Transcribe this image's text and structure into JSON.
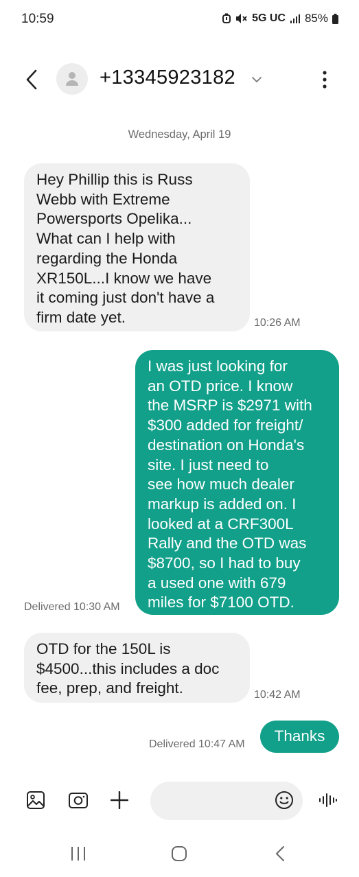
{
  "status": {
    "time": "10:59",
    "network": "5G UC",
    "battery": "85%",
    "icons": [
      "alarm-icon",
      "mute-icon",
      "signal-icon",
      "battery-icon"
    ]
  },
  "header": {
    "contact": "+13345923182",
    "icons": [
      "back-icon",
      "avatar-icon",
      "chevron-down-icon",
      "more-vert-icon"
    ]
  },
  "conversation": {
    "date": "Wednesday, April 19",
    "messages": [
      {
        "direction": "incoming",
        "lines": [
          "Hey Phillip this is Russ",
          "Webb with Extreme",
          "Powersports Opelika...",
          "What can I help with",
          "regarding the Honda",
          "XR150L...I know we have",
          "it coming just don't have a",
          "firm date yet."
        ],
        "time": "10:26 AM"
      },
      {
        "direction": "outgoing",
        "lines": [
          "I was just looking for",
          "an OTD price. I know",
          "the MSRP is $2971 with",
          "$300 added for freight/",
          "destination on Honda's",
          "site. I just need to",
          "see how much dealer",
          "markup is added on. I",
          "looked at a CRF300L",
          "Rally and the OTD was",
          "$8700, so I had to buy",
          "a used one with 679",
          "miles for $7100 OTD."
        ],
        "status": "Delivered 10:30 AM"
      },
      {
        "direction": "incoming",
        "lines": [
          "OTD for the 150L is",
          "$4500...this includes a doc",
          "fee, prep, and freight."
        ],
        "time": "10:42 AM"
      },
      {
        "direction": "outgoing",
        "lines": [
          "Thanks"
        ],
        "status": "Delivered 10:47 AM"
      }
    ]
  },
  "composer": {
    "placeholder": "",
    "icons": [
      "gallery-icon",
      "camera-icon",
      "plus-icon",
      "emoji-icon",
      "voice-icon"
    ]
  },
  "navbar": {
    "icons": [
      "recent-apps-icon",
      "home-icon",
      "back-nav-icon"
    ]
  },
  "colors": {
    "outgoing_bubble": "#12a08a",
    "incoming_bubble": "#f0f0f0",
    "meta_text": "#6b6b6b"
  }
}
